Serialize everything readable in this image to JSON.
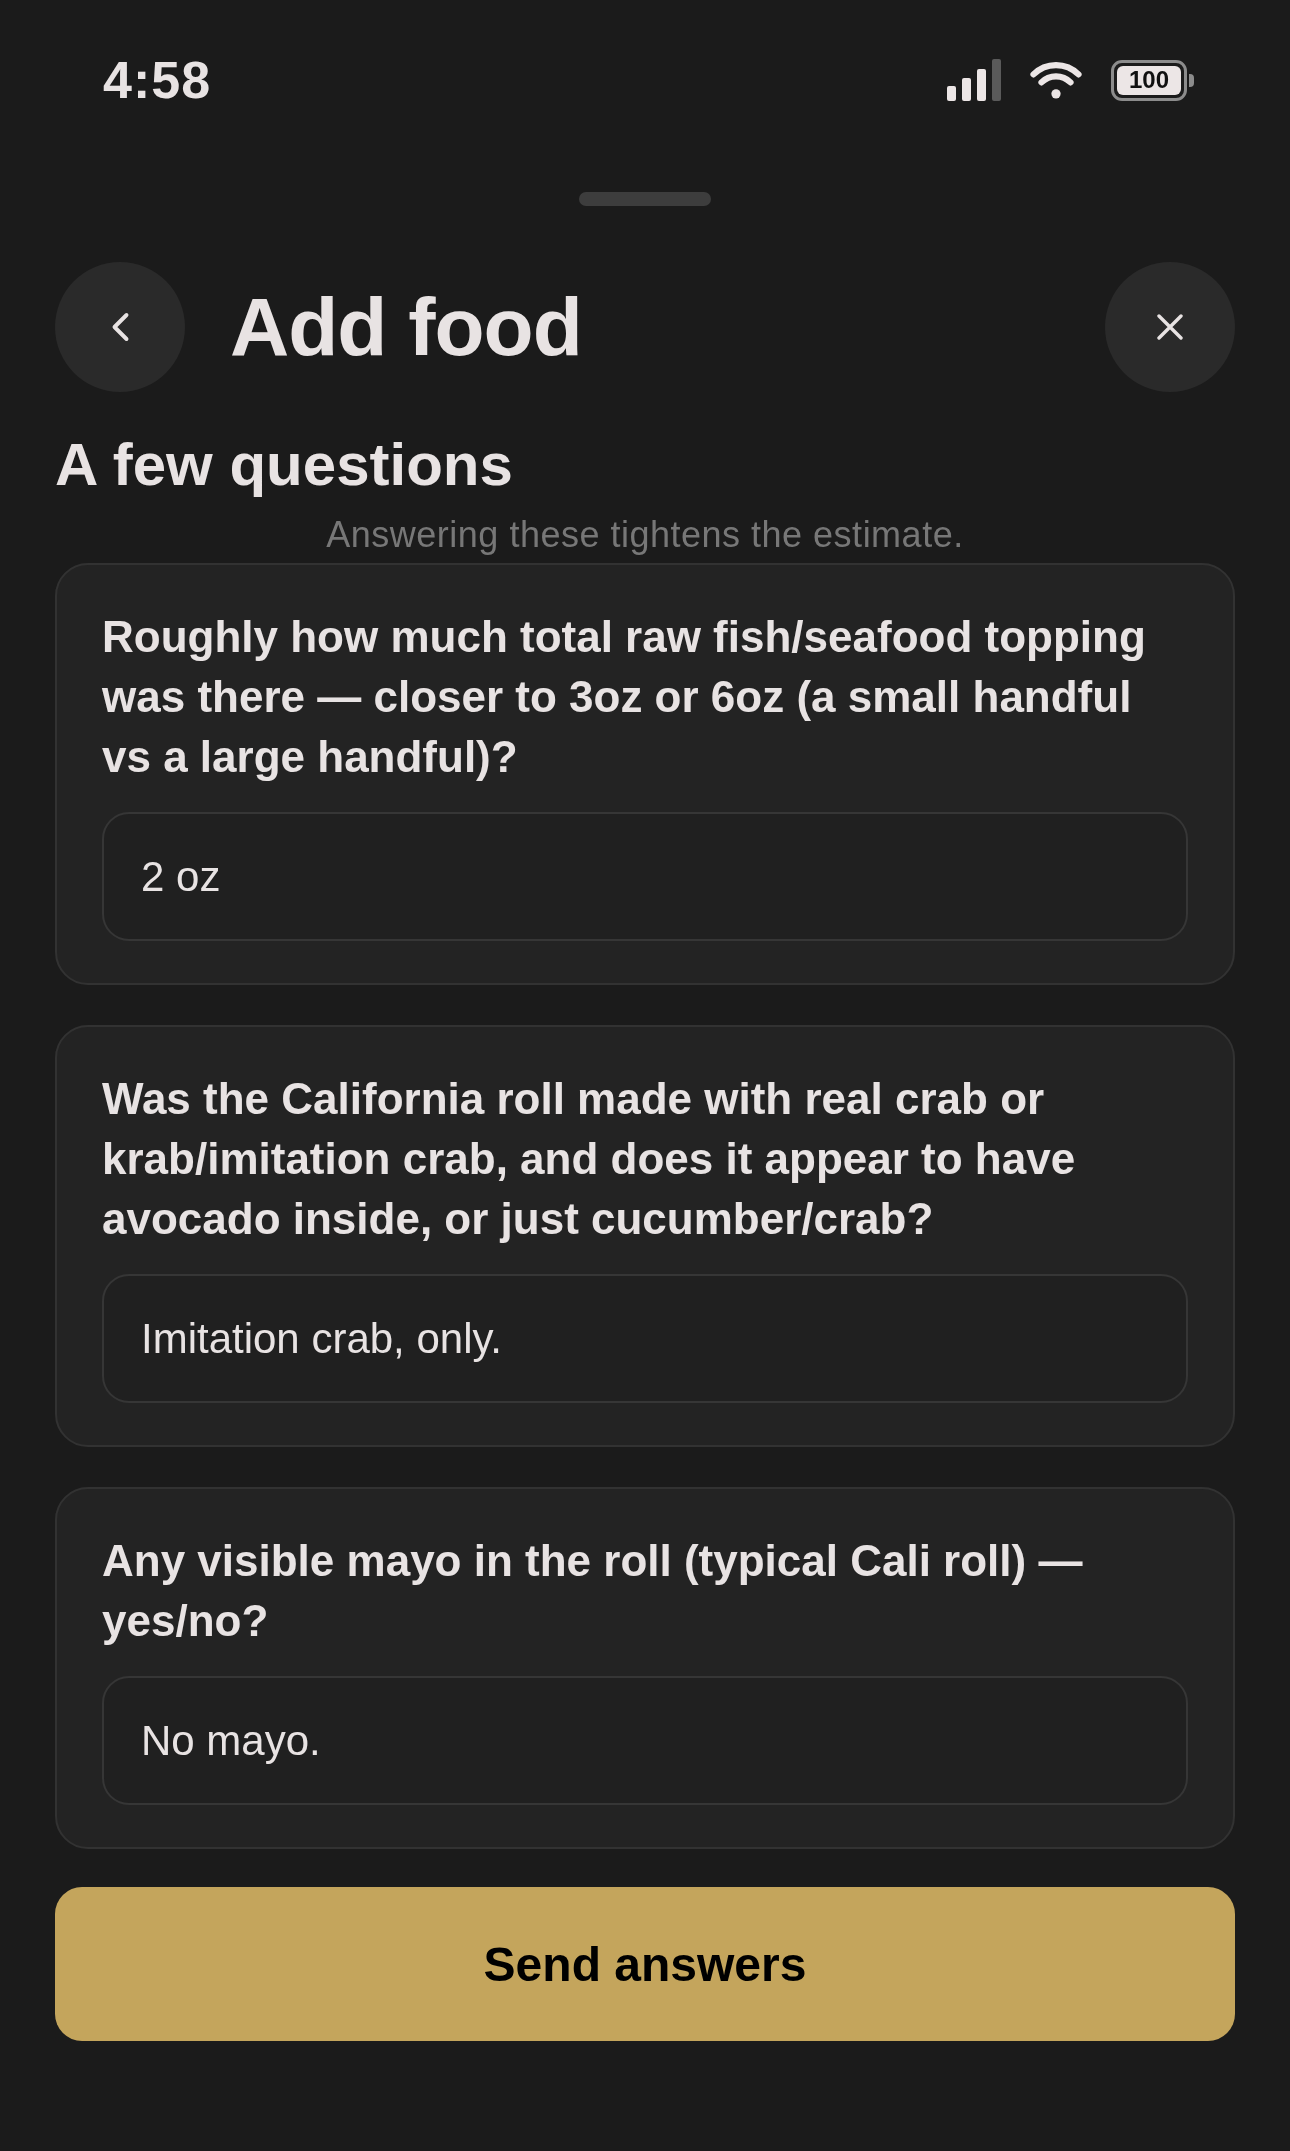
{
  "status_bar": {
    "time": "4:58",
    "battery": "100"
  },
  "header": {
    "title": "Add food"
  },
  "section": {
    "title": "A few questions",
    "subtitle": "Answering these tightens the estimate."
  },
  "questions": [
    {
      "question": "Roughly how much total raw fish/seafood topping was there — closer to 3oz or 6oz (a small handful vs a large handful)?",
      "answer": "2 oz"
    },
    {
      "question": "Was the California roll made with real crab or krab/imitation crab, and does it appear to have avocado inside, or just cucumber/crab?",
      "answer": "Imitation crab, only."
    },
    {
      "question": "Any visible mayo in the roll (typical Cali roll) — yes/no?",
      "answer": "No mayo."
    }
  ],
  "submit_button": {
    "label": "Send answers"
  }
}
